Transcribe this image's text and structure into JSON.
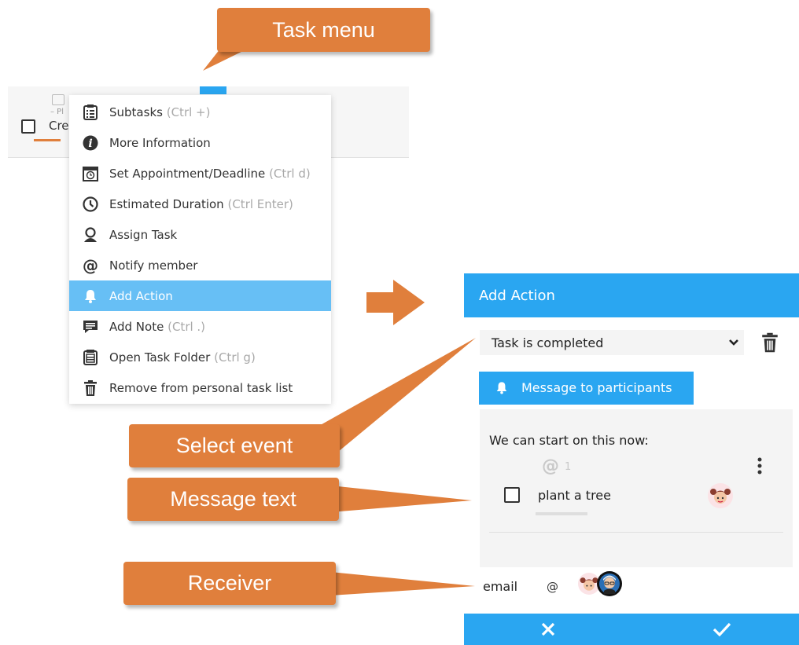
{
  "callouts": {
    "task_menu": "Task menu",
    "select_event": "Select event",
    "message_text": "Message text",
    "receiver": "Receiver"
  },
  "task_row": {
    "appointment_fragment": "– Pl",
    "title_fragment": "Cre"
  },
  "menu": {
    "items": [
      {
        "label": "Subtasks",
        "shortcut": "(Ctrl +)",
        "icon": "subtasks-icon"
      },
      {
        "label": "More Information",
        "shortcut": "",
        "icon": "info-icon"
      },
      {
        "label": "Set Appointment/Deadline",
        "shortcut": "(Ctrl d)",
        "icon": "calendar-clock-icon"
      },
      {
        "label": "Estimated Duration",
        "shortcut": "(Ctrl Enter)",
        "icon": "clock-icon"
      },
      {
        "label": "Assign Task",
        "shortcut": "",
        "icon": "person-icon"
      },
      {
        "label": "Notify member",
        "shortcut": "",
        "icon": "at-icon"
      },
      {
        "label": "Add Action",
        "shortcut": "",
        "icon": "bell-icon"
      },
      {
        "label": "Add Note",
        "shortcut": "(Ctrl .)",
        "icon": "note-icon"
      },
      {
        "label": "Open Task Folder",
        "shortcut": "(Ctrl g)",
        "icon": "folder-icon"
      },
      {
        "label": "Remove from personal task list",
        "shortcut": "",
        "icon": "trash-icon"
      }
    ]
  },
  "panel": {
    "title": "Add Action",
    "event_select_value": "Task is completed",
    "message_button_label": "Message to participants",
    "message_text": "We can start on this now:",
    "mention_count": "1",
    "subtask_label": "plant a tree",
    "receiver_label": "email",
    "receiver_at": "@",
    "cancel_icon": "close-icon",
    "confirm_icon": "check-icon"
  },
  "colors": {
    "accent_blue": "#2aa6f1",
    "menu_highlight": "#67bff5",
    "callout_orange": "#e07f3c"
  }
}
